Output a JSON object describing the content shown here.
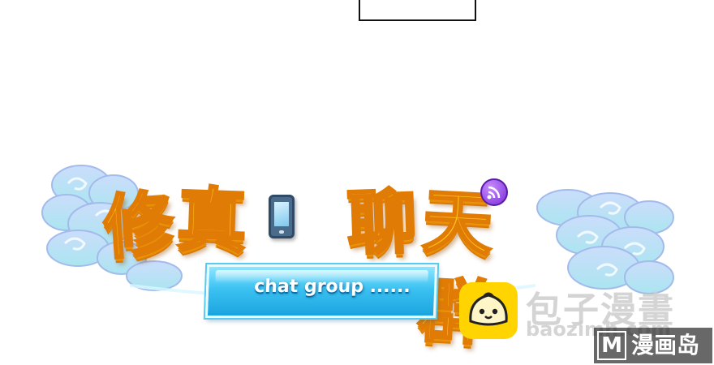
{
  "logo": {
    "title_glyphs": [
      "修",
      "真",
      "聊",
      "天群"
    ],
    "subtitle": "chat group ......",
    "colors": {
      "title_fill": "#ffc21a",
      "title_outline": "#e07c05",
      "banner": "#3cc2f2",
      "clouds": "#a9c8f2",
      "badge": "#7a2fd6"
    },
    "icons": [
      "smartphone-icon",
      "wifi-icon",
      "cloud-decoration"
    ]
  },
  "watermark": {
    "site_cn": "包子漫畫",
    "site_url": "baozimh.com",
    "badge_letter": "M",
    "badge_text": "漫画岛",
    "icons": [
      "bun-face-icon"
    ]
  }
}
